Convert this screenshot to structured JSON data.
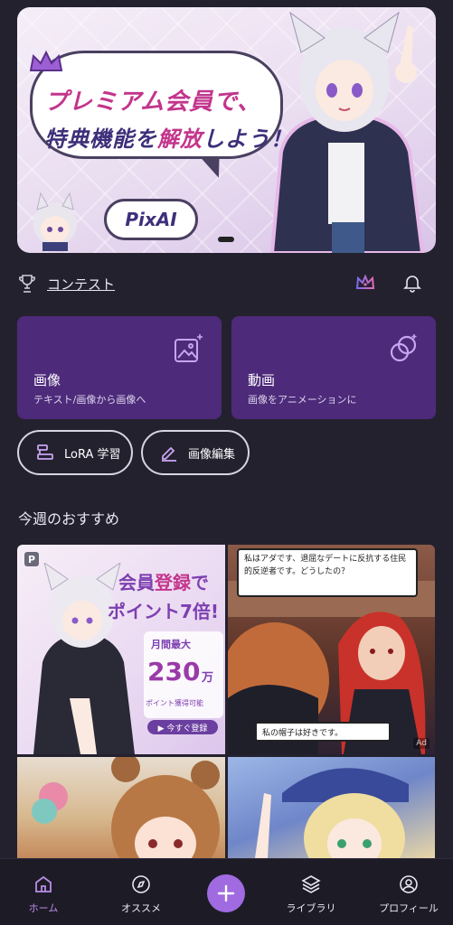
{
  "hero": {
    "line1": "プレミアム会員で、",
    "line2a": "特典機能を",
    "line2b": "解放",
    "line2c": "しよう！",
    "brand": "PixAI"
  },
  "contest": {
    "label": "コンテスト"
  },
  "cards": [
    {
      "title": "画像",
      "subtitle": "テキスト/画像から画像へ",
      "icon": "image-sparkle-icon"
    },
    {
      "title": "動画",
      "subtitle": "画像をアニメーションに",
      "icon": "video-circles-icon"
    }
  ],
  "pills": [
    {
      "label": "LoRA 学習",
      "icon": "lora-train-icon"
    },
    {
      "label": "画像編集",
      "icon": "pencil-icon"
    }
  ],
  "section_title": "今週のおすすめ",
  "promo": {
    "badge": "P",
    "line1a": "会員",
    "line1b": "登録",
    "line1c": "で",
    "line2": "ポイント7倍!",
    "max_label": "月間最大",
    "number": "230",
    "unit": "万",
    "note": "ポイント獲得可能",
    "button": "▶ 今すぐ登録"
  },
  "comic": {
    "speech1": "私はアダです、退屈なデートに反抗する住民的反逆者です。どうしたの？",
    "speech2": "私の帽子は好きです。",
    "ad": "Ad"
  },
  "nav": {
    "home": "ホーム",
    "osusume": "オススメ",
    "library": "ライブラリ",
    "profile": "プロフィール"
  },
  "colors": {
    "accent": "#a06be0",
    "card_bg": "#4d2a7a",
    "page_bg": "#24212f"
  }
}
